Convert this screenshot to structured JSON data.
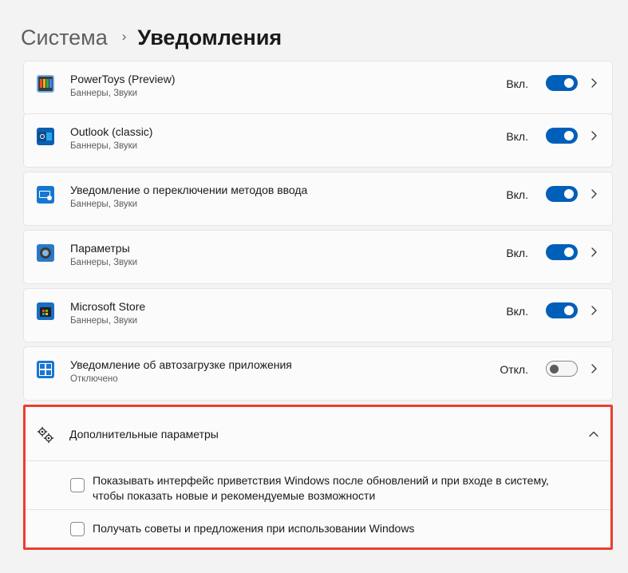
{
  "header": {
    "parent": "Система",
    "separator": "›",
    "current": "Уведомления"
  },
  "apps": [
    {
      "name": "PowerToys (Preview)",
      "sub": "Баннеры, Звуки",
      "state": "Вкл.",
      "on": true,
      "icon": "powertoys-icon"
    },
    {
      "name": "Outlook (classic)",
      "sub": "Баннеры, Звуки",
      "state": "Вкл.",
      "on": true,
      "icon": "outlook-icon"
    },
    {
      "name": "Уведомление о переключении методов ввода",
      "sub": "Баннеры, Звуки",
      "state": "Вкл.",
      "on": true,
      "icon": "input-method-icon"
    },
    {
      "name": "Параметры",
      "sub": "Баннеры, Звуки",
      "state": "Вкл.",
      "on": true,
      "icon": "settings-app-icon"
    },
    {
      "name": "Microsoft Store",
      "sub": "Баннеры, Звуки",
      "state": "Вкл.",
      "on": true,
      "icon": "microsoft-store-icon"
    },
    {
      "name": "Уведомление об автозагрузке приложения",
      "sub": "Отключено",
      "state": "Откл.",
      "on": false,
      "icon": "startup-app-icon"
    }
  ],
  "additional": {
    "title": "Дополнительные параметры",
    "options": [
      {
        "line1": "Показывать интерфейс приветствия Windows после обновлений и при входе в систему,",
        "line2": "чтобы показать новые и рекомендуемые возможности",
        "checked": false
      },
      {
        "line1": "Получать советы и предложения при использовании Windows",
        "checked": false
      }
    ]
  },
  "colors": {
    "accent": "#005fb8",
    "highlight_border": "#e8402e",
    "background": "#f3f3f3",
    "card": "#fbfbfb"
  }
}
